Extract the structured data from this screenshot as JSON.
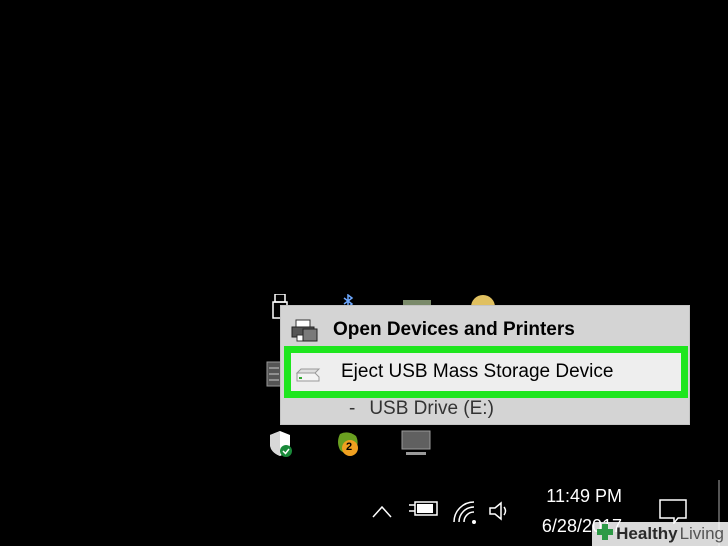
{
  "menu": {
    "open_devices": {
      "label": "Open Devices and Printers",
      "icon": "printer-icon"
    },
    "eject": {
      "label": "Eject USB Mass Storage Device",
      "icon": "usb-drive-icon"
    },
    "drive": {
      "prefix": "-",
      "label": "USB Drive (E:)"
    }
  },
  "highlight_color": "#1ee61e",
  "tray_overflow": {
    "icons": [
      "usb-icon",
      "bluetooth-icon",
      "printer-tray-icon",
      "user-icon",
      "server-icon",
      "defender-shield-icon",
      "updates-badge-icon",
      "network-monitor-icon"
    ],
    "badge_count": "2"
  },
  "taskbar": {
    "icons": [
      "chevron-up-icon",
      "power-plug-icon",
      "wifi-icon",
      "volume-icon",
      "action-center-icon"
    ],
    "time": "11:49 PM",
    "date": "6/28/2017"
  },
  "watermark": {
    "part1": "Healthy",
    "part2": "Living"
  }
}
